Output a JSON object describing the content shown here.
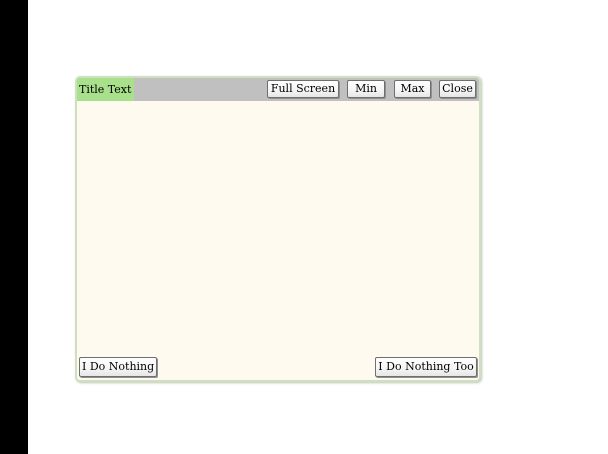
{
  "window": {
    "title": "Title Text",
    "buttons": {
      "full_screen": "Full Screen",
      "min": "Min",
      "max": "Max",
      "close": "Close"
    },
    "footer": {
      "left_button": "I Do Nothing",
      "right_button": "I Do Nothing Too"
    }
  },
  "colors": {
    "title_highlight": "#a8e08c",
    "titlebar": "#c0c0c0",
    "window_body": "#fffaf0",
    "left_bar": "#000000"
  }
}
